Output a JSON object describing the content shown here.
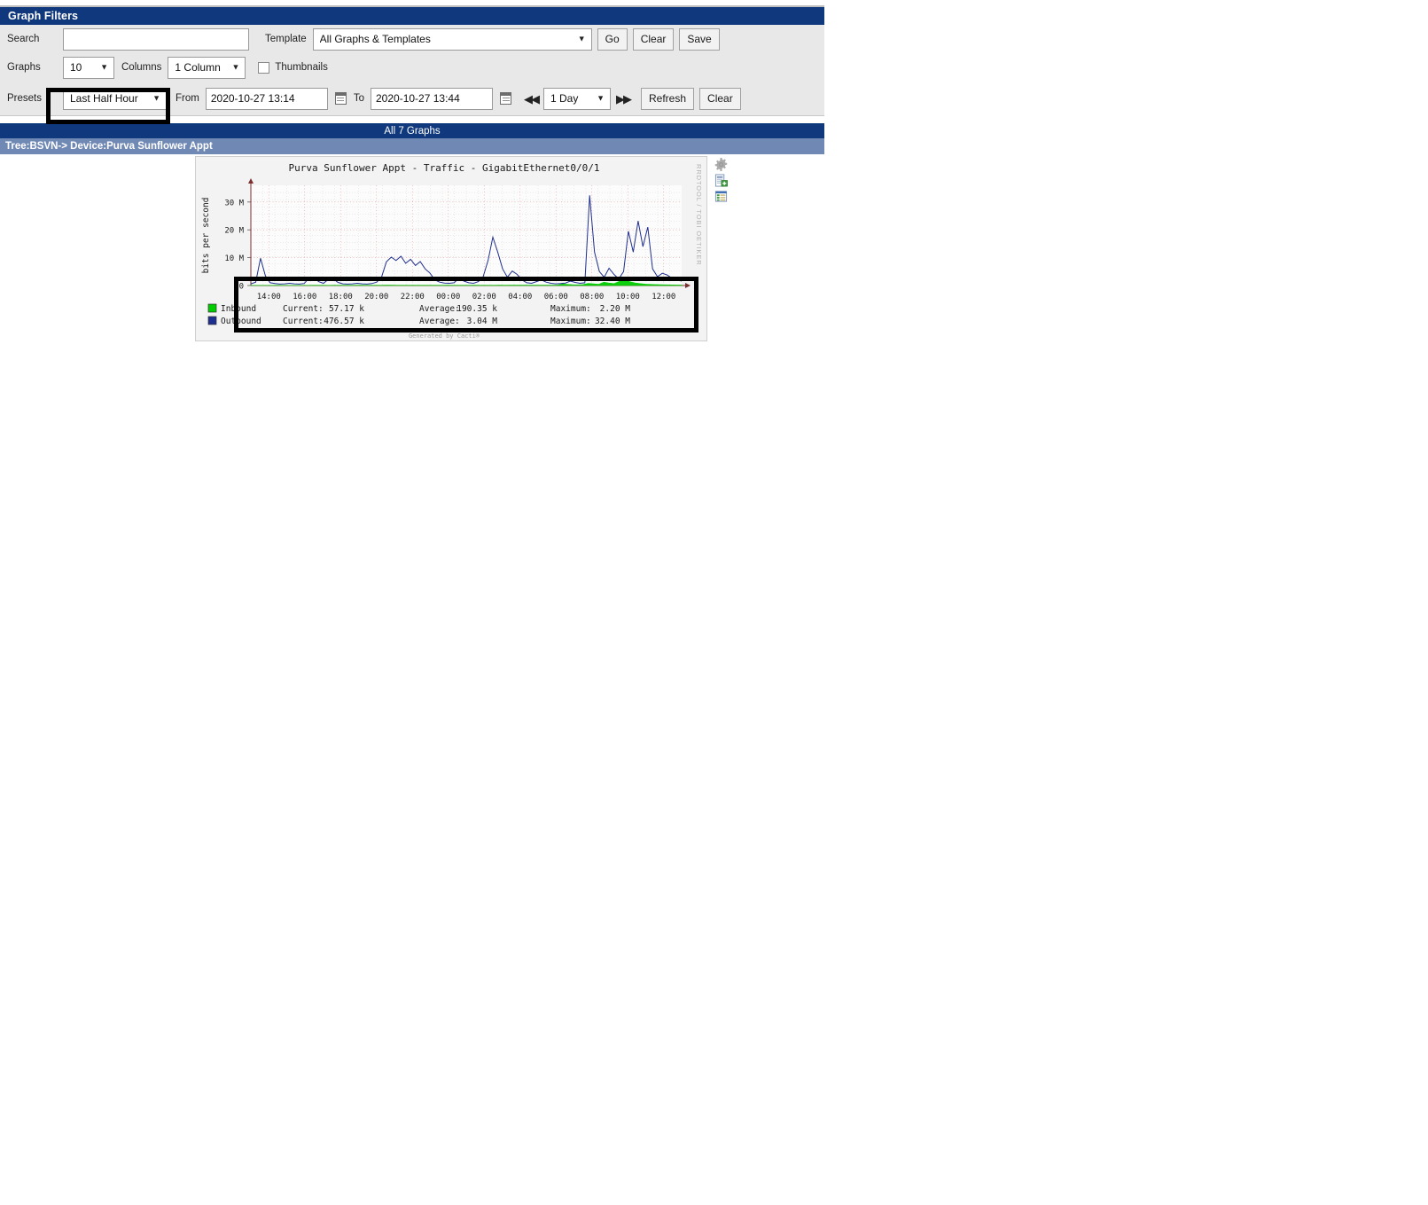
{
  "panel": {
    "title": "Graph Filters"
  },
  "filters": {
    "search_label": "Search",
    "search_value": "",
    "search_placeholder": "",
    "template_label": "Template",
    "template_value": "All Graphs & Templates",
    "template_options": [
      "All Graphs & Templates"
    ],
    "go_label": "Go",
    "clear_label": "Clear",
    "save_label": "Save",
    "graphs_label": "Graphs",
    "graphs_value": "10",
    "graphs_options": [
      "10"
    ],
    "columns_label": "Columns",
    "columns_value": "1 Column",
    "columns_options": [
      "1 Column"
    ],
    "thumbnails_label": "Thumbnails",
    "thumbnails_checked": false,
    "presets_label": "Presets",
    "presets_value": "Last Half Hour",
    "presets_options": [
      "Last Half Hour"
    ],
    "from_label": "From",
    "from_value": "2020-10-27 13:14",
    "to_label": "To",
    "to_value": "2020-10-27 13:44",
    "timespan_value": "1 Day",
    "timespan_options": [
      "1 Day"
    ],
    "nav_prev": "◀◀",
    "nav_next": "▶▶",
    "refresh_label": "Refresh",
    "clear2_label": "Clear"
  },
  "bars": {
    "all_graphs": "All 7 Graphs",
    "breadcrumb": "Tree:BSVN-> Device:Purva Sunflower Appt"
  },
  "icons": {
    "settings": "gear-icon",
    "csv_export": "csv-export-icon",
    "properties": "properties-icon"
  },
  "graph": {
    "credit": "RRDTOOL / TOBI OETIKER",
    "footer": "Generated by Cacti®"
  },
  "chart_data": {
    "type": "line",
    "title": "Purva Sunflower Appt - Traffic - GigabitEthernet0/0/1",
    "xlabel": "",
    "ylabel": "bits per second",
    "ylim": [
      0,
      36000000
    ],
    "yticks": [
      0,
      10000000,
      20000000,
      30000000
    ],
    "ytick_labels": [
      "0",
      "10 M",
      "20 M",
      "30 M"
    ],
    "xtick_labels": [
      "14:00",
      "16:00",
      "18:00",
      "20:00",
      "22:00",
      "00:00",
      "02:00",
      "04:00",
      "06:00",
      "08:00",
      "10:00",
      "12:00"
    ],
    "grid": true,
    "legend_position": "below",
    "legend_columns": [
      "Current:",
      "Average:",
      "Maximum:"
    ],
    "series": [
      {
        "name": "Inbound",
        "color": "#00cc00",
        "style": "area",
        "current": "57.17 k",
        "average": "190.35 k",
        "maximum": "2.20 M",
        "values": [
          0.05,
          0.06,
          0.05,
          0.07,
          0.06,
          0.08,
          0.07,
          0.06,
          0.05,
          0.06,
          0.07,
          0.06,
          0.08,
          0.09,
          0.08,
          0.07,
          0.09,
          0.1,
          0.09,
          0.08,
          0.1,
          0.12,
          0.11,
          0.1,
          0.09,
          0.11,
          0.13,
          0.12,
          0.1,
          0.09,
          0.11,
          0.1,
          0.09,
          0.08,
          0.1,
          0.09,
          0.11,
          0.1,
          0.12,
          0.11,
          0.09,
          0.1,
          0.11,
          0.12,
          0.1,
          0.09,
          0.11,
          0.1,
          0.12,
          0.11,
          0.13,
          0.12,
          0.14,
          0.15,
          0.13,
          0.12,
          0.14,
          0.16,
          0.15,
          0.13,
          0.55,
          0.4,
          0.3,
          0.25,
          0.35,
          0.8,
          0.6,
          0.45,
          1.2,
          0.9,
          0.7,
          1.5,
          2.2,
          1.4,
          0.95,
          0.7,
          0.5,
          0.4,
          0.35,
          0.3,
          0.25,
          0.22,
          0.2,
          0.18
        ]
      },
      {
        "name": "Outbound",
        "color": "#1f2f8f",
        "style": "line",
        "current": "476.57 k",
        "average": "3.04 M",
        "maximum": "32.40 M",
        "values": [
          0.6,
          1.2,
          9.8,
          3.5,
          1.0,
          0.7,
          0.5,
          0.6,
          0.8,
          0.6,
          0.5,
          0.7,
          2.6,
          2.8,
          1.4,
          0.8,
          2.2,
          2.4,
          1.1,
          0.6,
          0.5,
          0.6,
          0.8,
          0.6,
          0.5,
          0.7,
          1.2,
          3.0,
          8.5,
          10.2,
          9.0,
          10.5,
          8.0,
          9.4,
          7.2,
          8.6,
          6.0,
          4.5,
          2.0,
          1.2,
          0.9,
          0.8,
          1.0,
          2.6,
          1.6,
          1.0,
          0.8,
          1.4,
          3.2,
          9.0,
          17.4,
          12.0,
          6.0,
          3.0,
          5.2,
          4.0,
          2.0,
          1.0,
          0.8,
          1.4,
          2.0,
          1.2,
          0.8,
          0.6,
          0.7,
          0.9,
          1.6,
          1.1,
          0.8,
          1.0,
          32.4,
          12.0,
          5.0,
          3.0,
          6.2,
          4.0,
          2.4,
          5.0,
          19.5,
          12.0,
          23.2,
          14.0,
          21.0,
          6.0,
          3.2,
          4.4,
          3.8,
          2.6,
          2.0,
          1.6
        ]
      }
    ]
  }
}
